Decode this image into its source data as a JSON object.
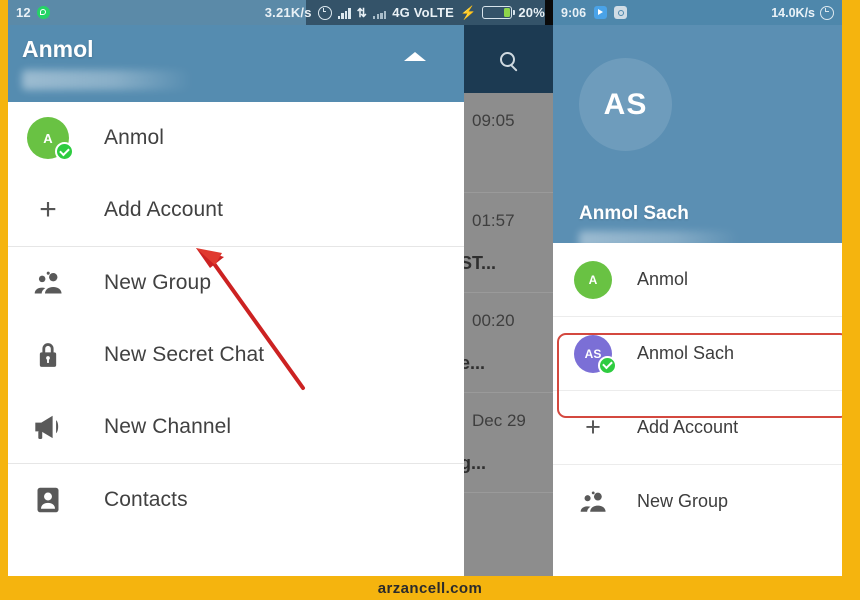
{
  "watermark": {
    "text": "arzancell.com"
  },
  "colors": {
    "frame_yellow": "#F5B40E",
    "telegram_blue": "#558cb0",
    "avatar_green": "#69C243",
    "avatar_purple": "#7B6FD6",
    "check_green": "#2ecc40",
    "highlight_red": "#d4483f",
    "arrow_red": "#cc2222"
  },
  "left_phone": {
    "statusbar": {
      "notification_count": "12",
      "whatsapp_icon": "whatsapp-icon",
      "network_speed": "3.21K/s",
      "alarm_icon": "alarm-clock-icon",
      "signal_icon": "signal-bars-icon",
      "data_transfer_icon": "data-transfer-icon",
      "signal_icon_2": "signal-bars-secondary-icon",
      "network_type": "4G VoLTE",
      "charging_icon": "charging-bolt-icon",
      "battery_icon": "battery-icon",
      "battery_level": "20%"
    },
    "drawer": {
      "account_name": "Anmol",
      "phone_number_blurred": "",
      "expand_chevron": "chevron-up-icon"
    },
    "menu": [
      {
        "label": "Anmol",
        "icon": "avatar-initial-icon",
        "initial": "A",
        "avatar_color": "green",
        "checked": true
      },
      {
        "label": "Add Account",
        "icon": "plus-icon",
        "initial": "",
        "avatar_color": "",
        "checked": false
      },
      {
        "label": "New Group",
        "icon": "group-people-icon",
        "initial": "",
        "avatar_color": "",
        "checked": false
      },
      {
        "label": "New Secret Chat",
        "icon": "lock-icon",
        "initial": "",
        "avatar_color": "",
        "checked": false
      },
      {
        "label": "New Channel",
        "icon": "megaphone-icon",
        "initial": "",
        "avatar_color": "",
        "checked": false
      },
      {
        "label": "Contacts",
        "icon": "contact-card-icon",
        "initial": "",
        "avatar_color": "",
        "checked": false
      }
    ],
    "background_chatlist": {
      "search_icon": "search-icon",
      "rows": [
        {
          "time": "09:05",
          "snippet": ""
        },
        {
          "time": "01:57",
          "snippet": "ST..."
        },
        {
          "time": "00:20",
          "snippet": "e..."
        },
        {
          "time": "Dec 29",
          "snippet": "g..."
        }
      ]
    }
  },
  "right_phone": {
    "statusbar": {
      "time": "9:06",
      "play_icon": "media-play-icon",
      "camera_icon": "camera-icon",
      "network_speed": "14.0K/s",
      "alarm_icon": "alarm-clock-icon"
    },
    "drawer": {
      "avatar_initials": "AS",
      "account_name": "Anmol Sach",
      "phone_number_blurred": ""
    },
    "menu": [
      {
        "label": "Anmol",
        "icon": "avatar-initial-icon",
        "initial": "A",
        "avatar_color": "green",
        "checked": false,
        "highlighted": false
      },
      {
        "label": "Anmol Sach",
        "icon": "avatar-initial-icon",
        "initial": "AS",
        "avatar_color": "purple",
        "checked": true,
        "highlighted": true
      },
      {
        "label": "Add Account",
        "icon": "plus-icon",
        "initial": "",
        "avatar_color": "",
        "checked": false,
        "highlighted": false
      },
      {
        "label": "New Group",
        "icon": "group-people-icon",
        "initial": "",
        "avatar_color": "",
        "checked": false,
        "highlighted": false
      }
    ]
  }
}
